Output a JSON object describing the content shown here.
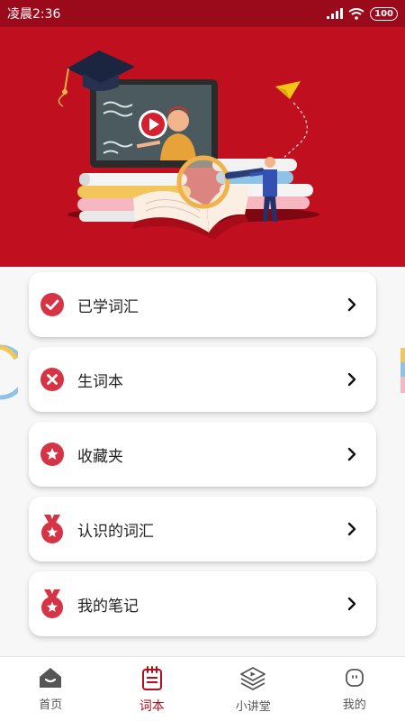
{
  "status": {
    "time": "凌晨2:36",
    "battery": "100"
  },
  "colors": {
    "brand": "#c0101f",
    "status_bar": "#9b0a1a",
    "icon_red": "#d63345",
    "tab_active": "#b50e1e"
  },
  "menu": {
    "items": [
      {
        "label": "已学词汇",
        "icon": "check-circle-icon"
      },
      {
        "label": "生词本",
        "icon": "x-circle-icon"
      },
      {
        "label": "收藏夹",
        "icon": "star-circle-icon"
      },
      {
        "label": "认识的词汇",
        "icon": "medal-icon"
      },
      {
        "label": "我的笔记",
        "icon": "medal-icon"
      }
    ]
  },
  "tabs": [
    {
      "label": "首页",
      "icon": "home-icon",
      "active": false
    },
    {
      "label": "词本",
      "icon": "notebook-icon",
      "active": true
    },
    {
      "label": "小讲堂",
      "icon": "video-layers-icon",
      "active": false
    },
    {
      "label": "我的",
      "icon": "profile-icon",
      "active": false
    }
  ]
}
